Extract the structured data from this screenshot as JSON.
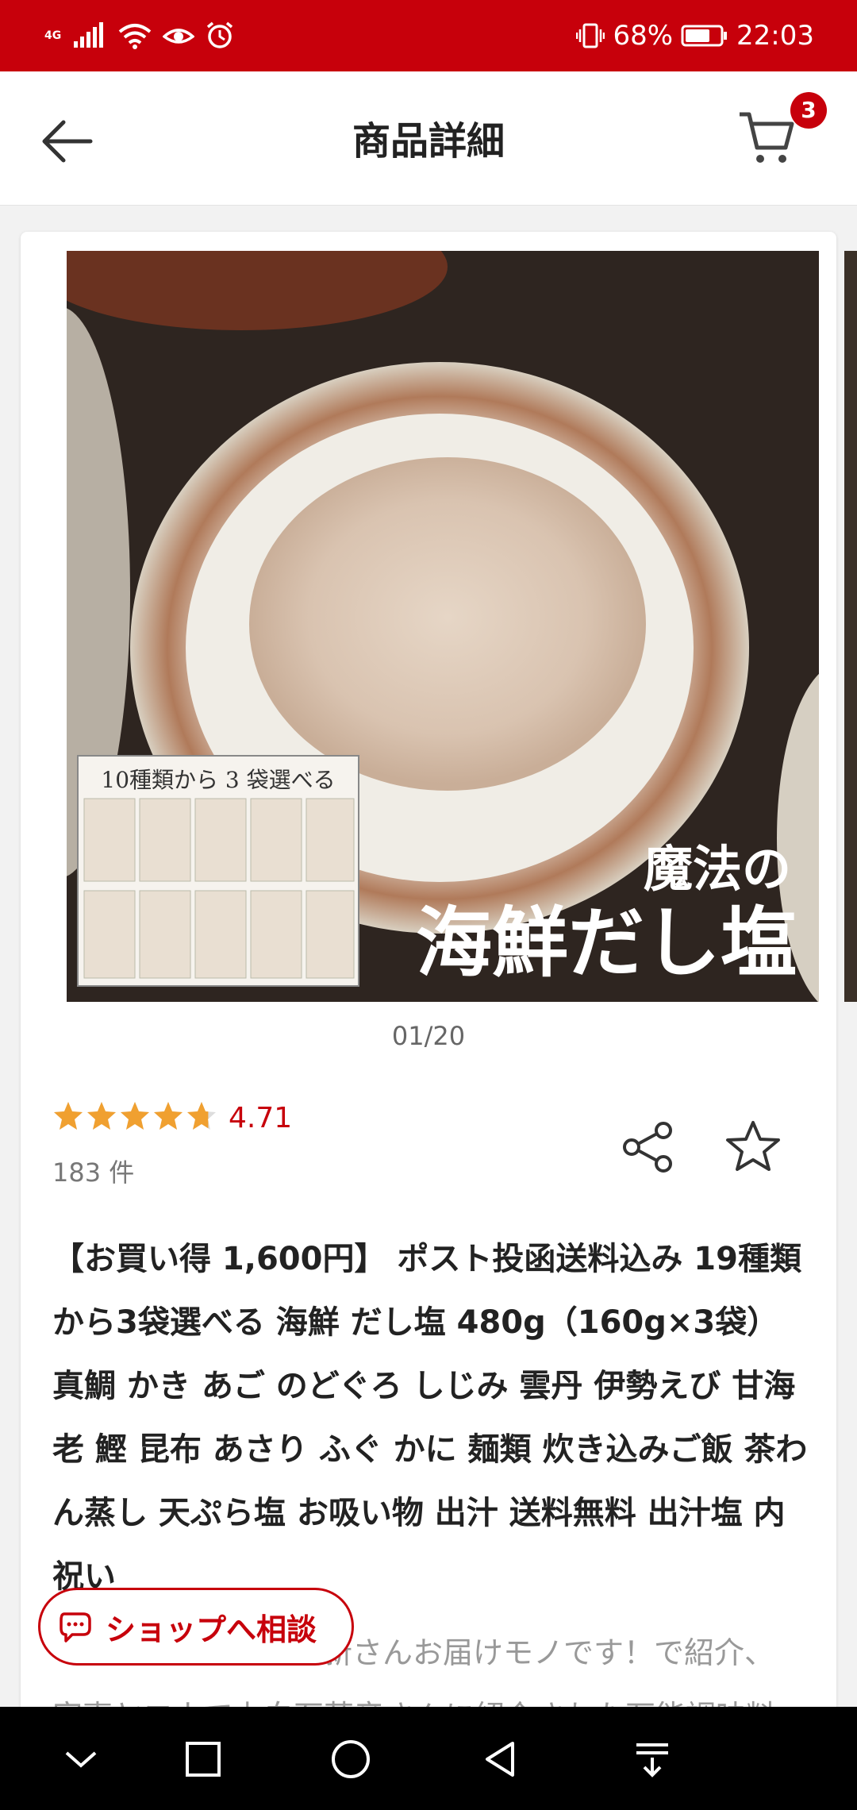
{
  "status_bar": {
    "network": "4G",
    "battery": "68%",
    "time": "22:03"
  },
  "header": {
    "title": "商品詳細",
    "cart_count": "3"
  },
  "gallery": {
    "counter": "01/20",
    "overlay": {
      "heading": "10種類から 3 袋選べる",
      "brand_line1": "魔法の",
      "brand_line2": "海鮮だし塩"
    }
  },
  "rating": {
    "score": "4.71",
    "stars_value": 4.71,
    "stars_max": 5,
    "count": "183 件"
  },
  "product": {
    "title": "【お買い得 1,600円】 ポスト投函送料込み 19種類から3袋選べる 海鮮 だし塩 480g（160g×3袋） 真鯛 かき あご のどぐろ しじみ 雲丹 伊勢えび 甘海老 鰹 昆布 あさり ふぐ かに 麺類 炊き込みご飯 茶わん蒸し 天ぷら塩 お吸い物 出汁 送料無料 出汁塩 内祝い",
    "desc_line1": "新さんお届けモノです！で紹介、",
    "desc_line2": "家事ヤロウで上白石萌音さんに紹介された万能調味料"
  },
  "shop_button": {
    "label": "ショップへ相談"
  },
  "colors": {
    "brand_red": "#c7000b",
    "star": "#f0a030"
  }
}
